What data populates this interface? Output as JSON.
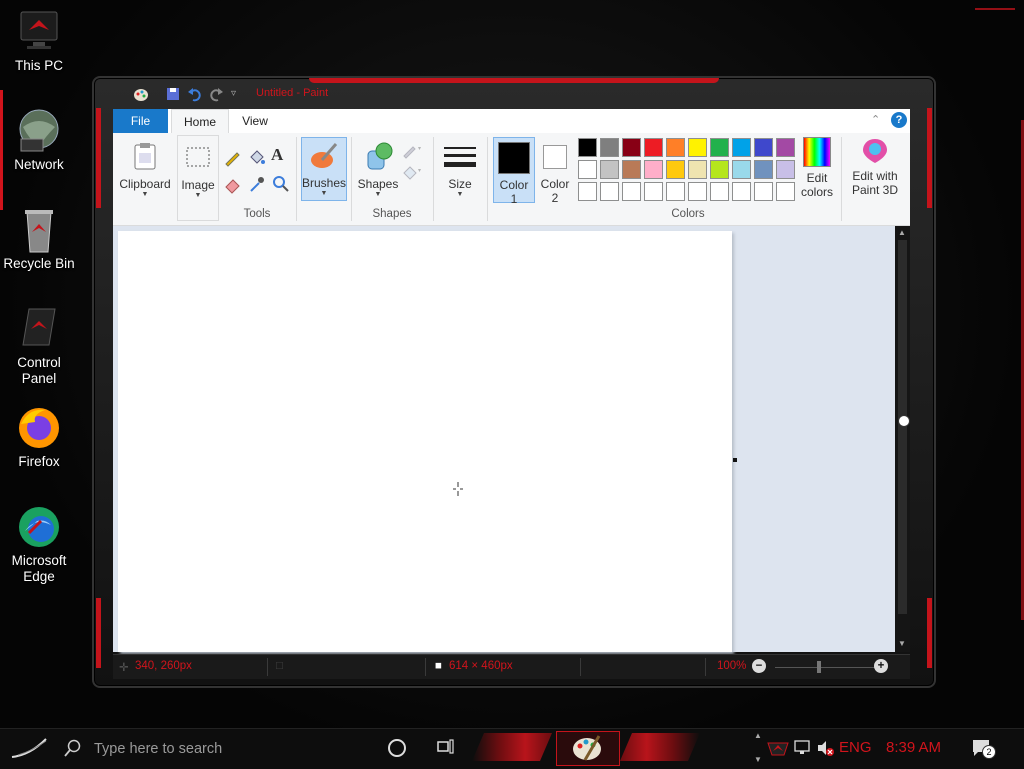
{
  "desktop": {
    "icons": [
      {
        "label": "This PC"
      },
      {
        "label": "Network"
      },
      {
        "label": "Recycle Bin"
      },
      {
        "label": "Control Panel"
      },
      {
        "label": "Firefox"
      },
      {
        "label": "Microsoft Edge"
      }
    ]
  },
  "window": {
    "title": "Untitled - Paint",
    "tabs": [
      {
        "label": "File"
      },
      {
        "label": "Home"
      },
      {
        "label": "View"
      }
    ],
    "ribbon": {
      "clipboard_label": "Clipboard",
      "image_label": "Image",
      "tools_group": "Tools",
      "brushes_label": "Brushes",
      "shapes_label": "Shapes",
      "shapes_group": "Shapes",
      "size_label": "Size",
      "color1_label": "Color",
      "color1_num": "1",
      "color2_label": "Color",
      "color2_num": "2",
      "colors_group": "Colors",
      "edit_colors_line1": "Edit",
      "edit_colors_line2": "colors",
      "paint3d_line1": "Edit with",
      "paint3d_line2": "Paint 3D",
      "color1_value": "#000000",
      "color2_value": "#ffffff",
      "palette_row1": [
        "#000000",
        "#7f7f7f",
        "#880015",
        "#ed1c24",
        "#ff7f27",
        "#fff200",
        "#22b14c",
        "#00a2e8",
        "#3f48cc",
        "#a349a4"
      ],
      "palette_row2": [
        "#ffffff",
        "#c3c3c3",
        "#b97a57",
        "#ffaec9",
        "#ffc90e",
        "#efe4b0",
        "#b5e61d",
        "#99d9ea",
        "#7092be",
        "#c8bfe7"
      ],
      "palette_row3": [
        "#ffffff",
        "#ffffff",
        "#ffffff",
        "#ffffff",
        "#ffffff",
        "#ffffff",
        "#ffffff",
        "#ffffff",
        "#ffffff",
        "#ffffff"
      ]
    },
    "status": {
      "cursor_pos": "340, 260px",
      "canvas_size": "614 × 460px",
      "zoom": "100%"
    }
  },
  "taskbar": {
    "search_placeholder": "Type here to search",
    "language": "ENG",
    "time": "8:39 AM",
    "notification_count": "2"
  }
}
